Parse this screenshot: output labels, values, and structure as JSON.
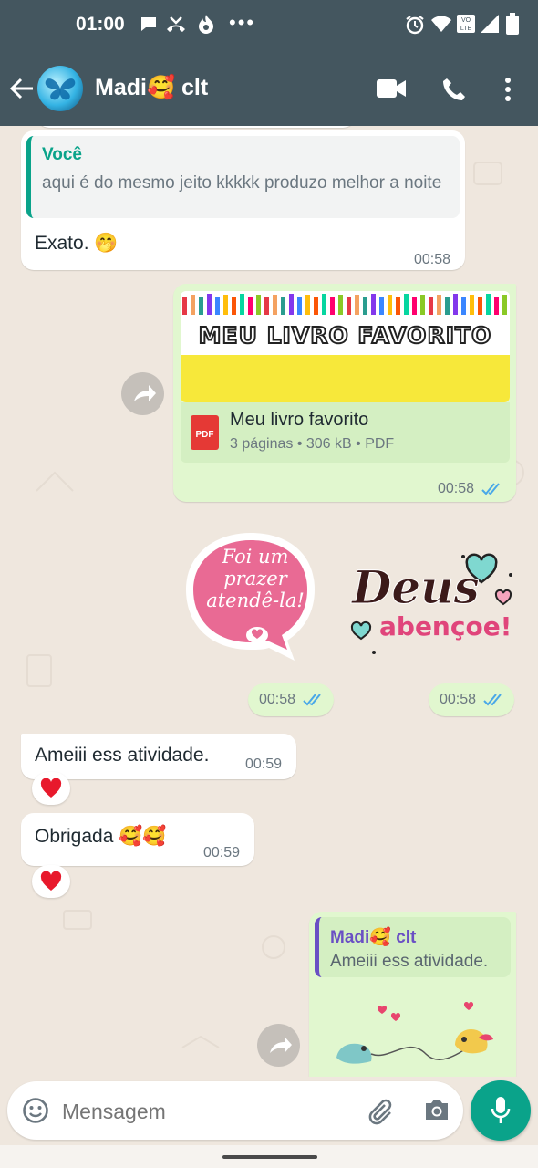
{
  "status": {
    "time": "01:00",
    "more": "•••"
  },
  "header": {
    "contact_name": "Madi🥰 clt"
  },
  "messages": {
    "quote1_author": "Você",
    "quote1_text": "aqui é do mesmo jeito kkkkk produzo melhor a noite",
    "reply1_text": "Exato. 🤭",
    "reply1_time": "00:58",
    "doc_banner_title": "MEU LIVRO FAVORITO",
    "doc_name": "Meu livro favorito",
    "doc_meta": "3 páginas • 306 kB • PDF",
    "doc_icon_label": "PDF",
    "doc_time": "00:58",
    "sticker1_text": "Foi um prazer atendê-la!",
    "sticker1_time": "00:58",
    "sticker2_line1": "Deus",
    "sticker2_line2": "abençoe!",
    "sticker2_time": "00:58",
    "msg_ameiii": "Ameiii ess atividade.",
    "msg_ameiii_time": "00:59",
    "reaction1": "❤️",
    "msg_obrigada": "Obrigada 🥰🥰",
    "msg_obrigada_time": "00:59",
    "reaction2": "❤️",
    "quote2_author": "Madi🥰 clt",
    "quote2_text": "Ameiii ess atividade."
  },
  "composer": {
    "placeholder": "Mensagem"
  },
  "colors": {
    "header": "#44565f",
    "chat_bg": "#efe7de",
    "out_bubble": "#e1f7cf",
    "accent_green": "#0aa38a",
    "read_ticks": "#4aa8e8"
  }
}
